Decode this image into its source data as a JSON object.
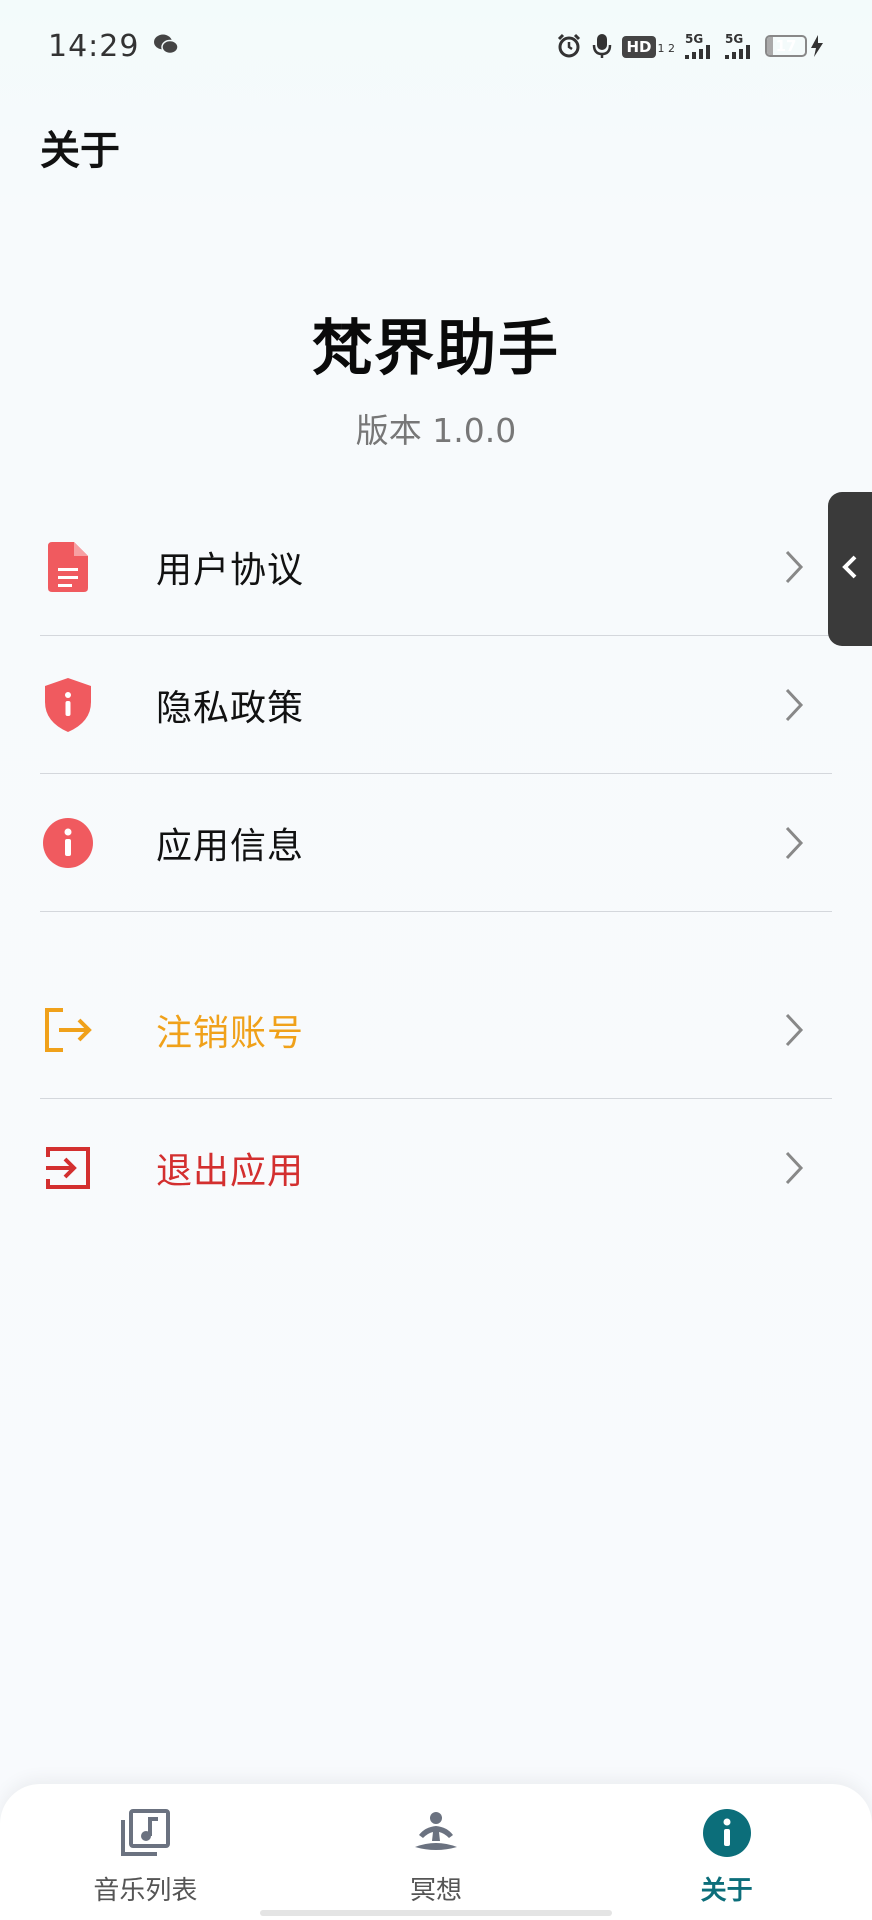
{
  "status_bar": {
    "time": "14:29",
    "hd_label": "HD",
    "hd_sub": "1 2",
    "sim1_label": "5G",
    "sim2_label": "5G",
    "battery_level": "17"
  },
  "header": {
    "title": "关于"
  },
  "app": {
    "name": "梵界助手",
    "version": "版本 1.0.0"
  },
  "menu": {
    "items": [
      {
        "label": "用户协议",
        "icon": "document-icon"
      },
      {
        "label": "隐私政策",
        "icon": "shield-info-icon"
      },
      {
        "label": "应用信息",
        "icon": "info-circle-icon"
      }
    ],
    "account_items": [
      {
        "label": "注销账号",
        "icon": "logout-arrow-icon"
      },
      {
        "label": "退出应用",
        "icon": "exit-box-icon"
      }
    ]
  },
  "colors": {
    "primary_red": "#f05a5f",
    "delete_orange": "#f0a11a",
    "exit_red": "#d32f2f",
    "active_teal": "#0c6e7a",
    "inactive_nav": "#6b7280"
  },
  "bottom_nav": {
    "items": [
      {
        "label": "音乐列表",
        "icon": "music-library-icon"
      },
      {
        "label": "冥想",
        "icon": "meditation-icon"
      },
      {
        "label": "关于",
        "icon": "info-icon"
      }
    ],
    "active_index": 2
  }
}
